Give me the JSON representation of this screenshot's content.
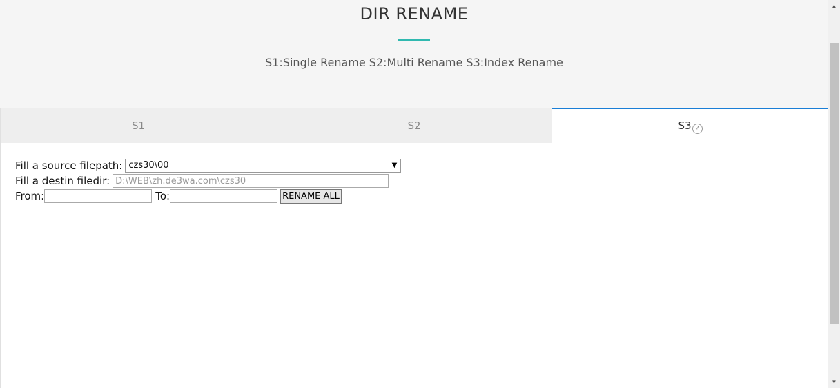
{
  "header": {
    "title": "DIR RENAME",
    "subtitle": "S1:Single Rename S2:Multi Rename S3:Index Rename",
    "accent_color": "#30b9b0"
  },
  "tabs": [
    {
      "label": "S1",
      "active": false
    },
    {
      "label": "S2",
      "active": false
    },
    {
      "label": "S3",
      "active": true,
      "help_icon": "?"
    }
  ],
  "form": {
    "source_label": "Fill a source filepath:",
    "source_value": "czs30\\00",
    "dest_label": "Fill a destin filedir:",
    "dest_placeholder": "D:\\WEB\\zh.de3wa.com\\czs30",
    "from_label": "From:",
    "from_value": "",
    "to_label": "To:",
    "to_value": "",
    "rename_button": "RENAME ALL"
  },
  "colors": {
    "active_tab_border": "#1a7ed6",
    "header_bg": "#f5f5f5"
  }
}
